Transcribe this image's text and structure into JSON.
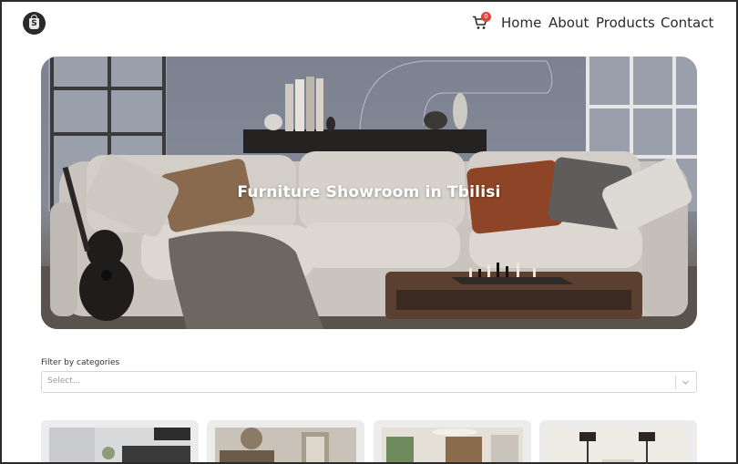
{
  "header": {
    "logo_icon": "shopify-bag-icon",
    "cart_icon": "shopping-cart-icon",
    "cart_count": "0",
    "nav": {
      "home": "Home",
      "about": "About",
      "products": "Products",
      "contact": "Contact"
    }
  },
  "hero": {
    "title": "Furniture Showroom in Tbilisi"
  },
  "filter": {
    "label": "Filter by categories",
    "placeholder": "Select...",
    "chevron_icon": "chevron-down-icon"
  },
  "colors": {
    "accent_badge": "#e0433a",
    "text": "#2a2a2a",
    "card_bg": "#ececec"
  }
}
